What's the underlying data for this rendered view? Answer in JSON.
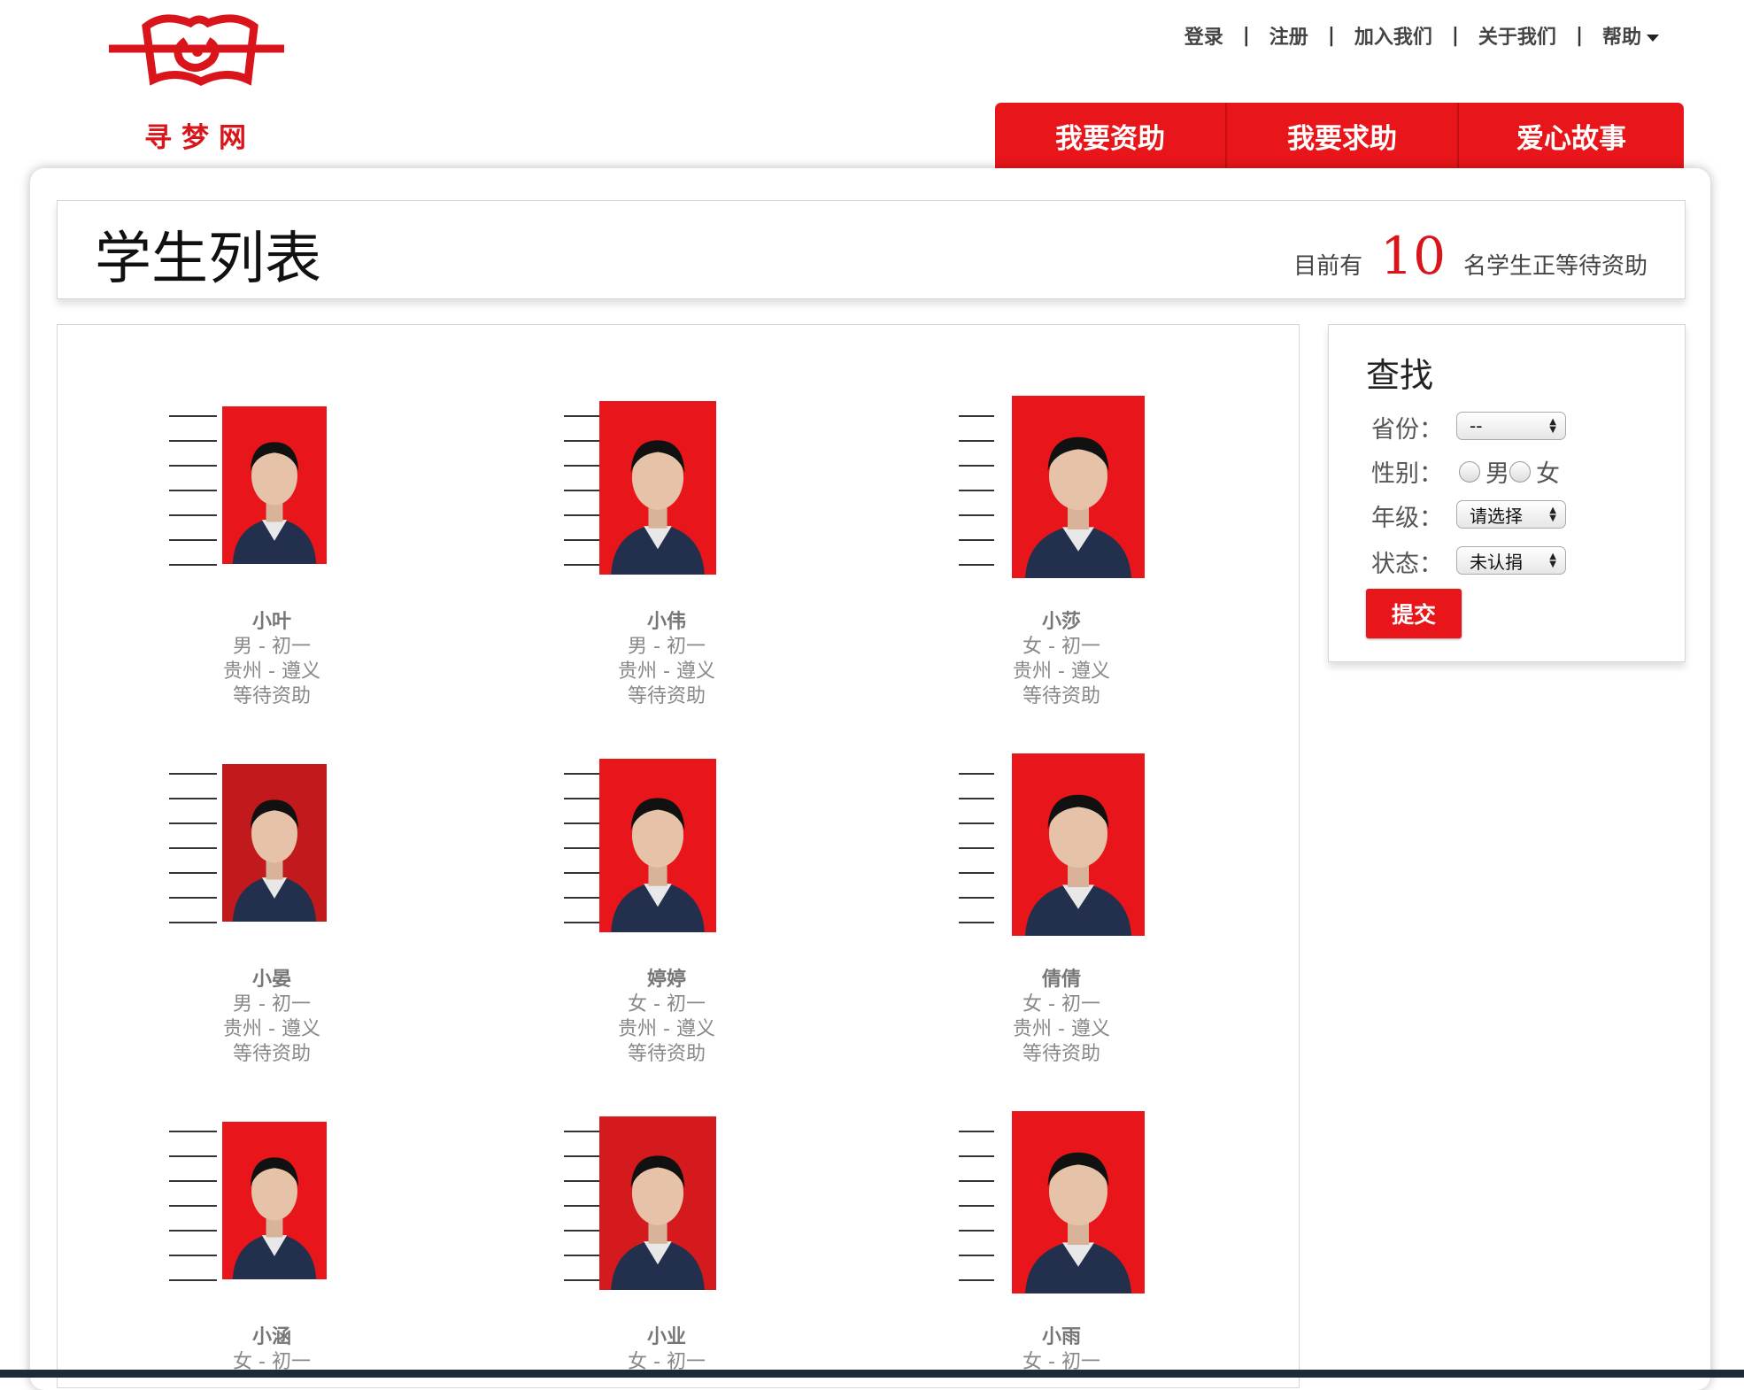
{
  "brand": {
    "logo_text": "寻梦网",
    "primary_color": "#e8161a"
  },
  "topnav": {
    "items": [
      "登录",
      "注册",
      "加入我们",
      "关于我们"
    ],
    "help_label": "帮助"
  },
  "tabs": [
    "我要资助",
    "我要求助",
    "爱心故事"
  ],
  "header": {
    "title": "学生列表",
    "count_prefix": "目前有",
    "count": "10",
    "count_suffix": "名学生正等待资助"
  },
  "students": [
    {
      "name": "小叶",
      "gender_grade": "男 - 初一",
      "location": "贵州 - 遵义",
      "status": "等待资助",
      "bg": "#e8161a"
    },
    {
      "name": "小伟",
      "gender_grade": "男 - 初一",
      "location": "贵州 - 遵义",
      "status": "等待资助",
      "bg": "#e8161a"
    },
    {
      "name": "小莎",
      "gender_grade": "女 - 初一",
      "location": "贵州 - 遵义",
      "status": "等待资助",
      "bg": "#e8161a"
    },
    {
      "name": "小晏",
      "gender_grade": "男 - 初一",
      "location": "贵州 - 遵义",
      "status": "等待资助",
      "bg": "#c21a1c"
    },
    {
      "name": "婷婷",
      "gender_grade": "女 - 初一",
      "location": "贵州 - 遵义",
      "status": "等待资助",
      "bg": "#e8161a"
    },
    {
      "name": "倩倩",
      "gender_grade": "女 - 初一",
      "location": "贵州 - 遵义",
      "status": "等待资助",
      "bg": "#e8161a"
    },
    {
      "name": "小涵",
      "gender_grade": "女 - 初一",
      "location": "",
      "status": "",
      "bg": "#e8161a"
    },
    {
      "name": "小业",
      "gender_grade": "女 - 初一",
      "location": "",
      "status": "",
      "bg": "#d41a1d"
    },
    {
      "name": "小雨",
      "gender_grade": "女 - 初一",
      "location": "",
      "status": "",
      "bg": "#e8161a"
    }
  ],
  "search": {
    "title": "查找",
    "province_label": "省份：",
    "province_value": "--",
    "gender_label": "性别：",
    "gender_male": "男",
    "gender_female": "女",
    "grade_label": "年级：",
    "grade_value": "请选择",
    "status_label": "状态：",
    "status_value": "未认捐",
    "submit_label": "提交"
  }
}
